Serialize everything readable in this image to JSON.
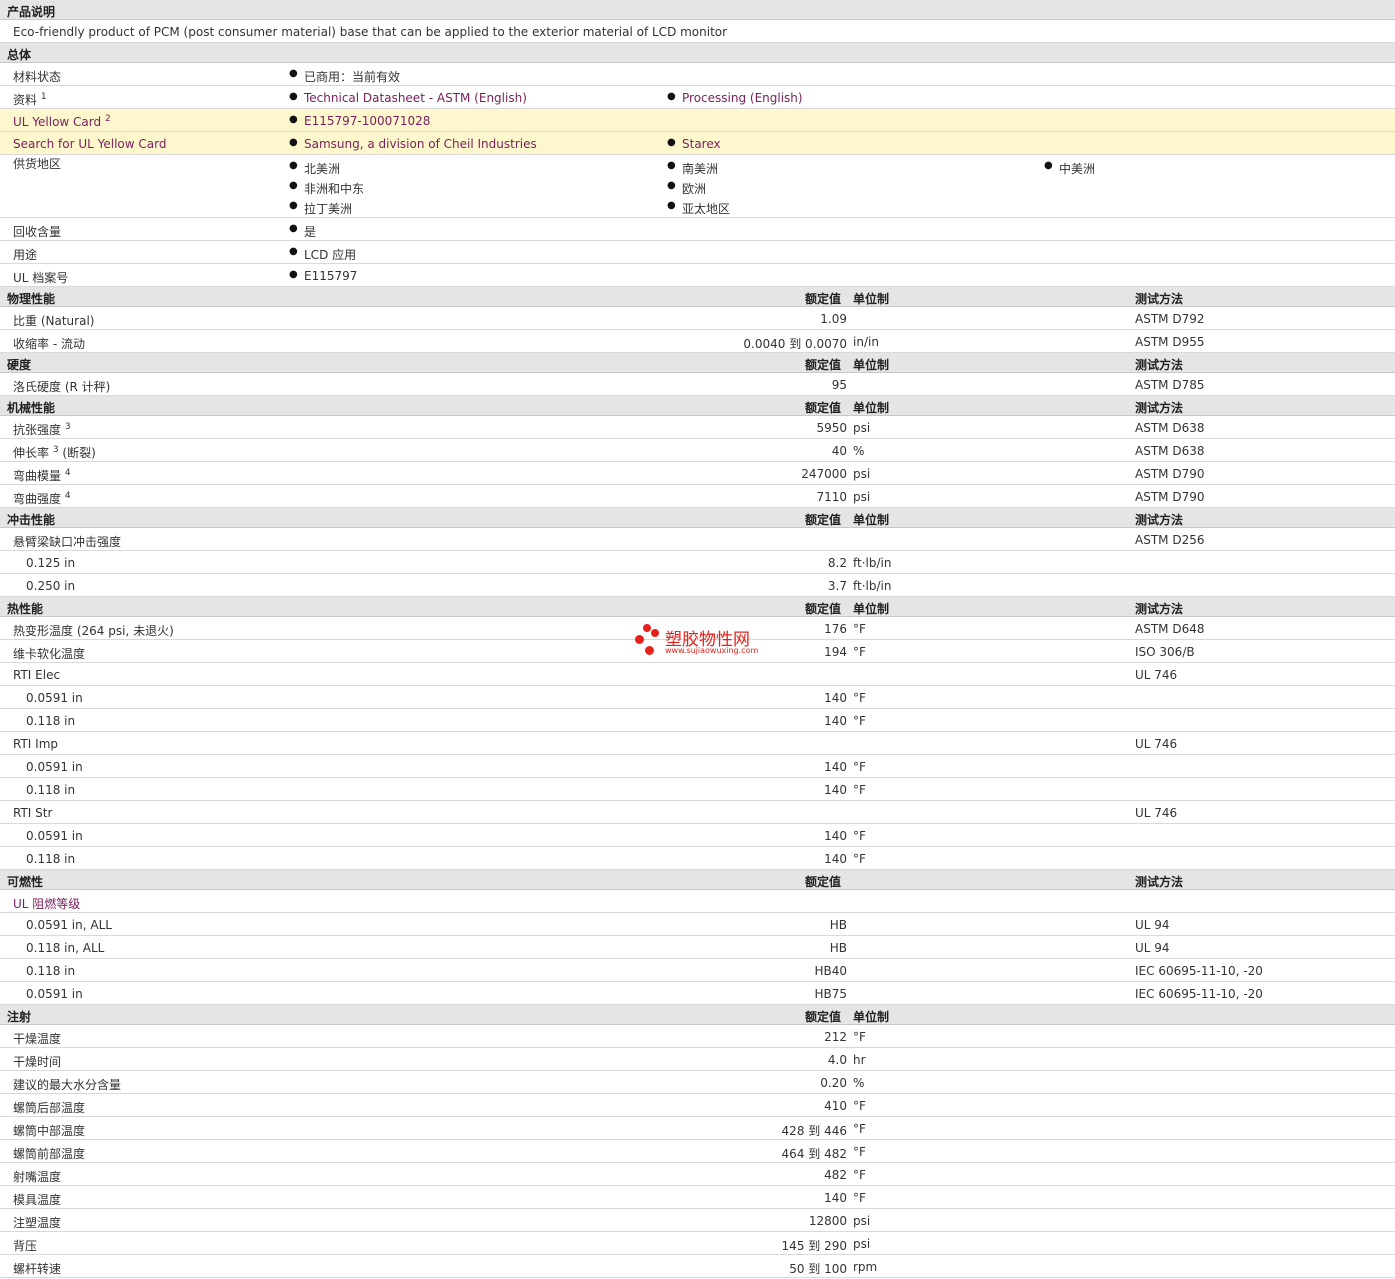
{
  "product_desc": {
    "header": "产品说明",
    "text": "Eco-friendly product of PCM (post consumer material) base that can be applied to the exterior material of LCD monitor"
  },
  "general": {
    "header": "总体",
    "material_status": {
      "label": "材料状态",
      "value": "已商用：当前有效"
    },
    "documents": {
      "label": "资料",
      "sup": "1",
      "items": [
        "Technical Datasheet - ASTM (English)",
        "Processing (English)"
      ]
    },
    "ul_yellow_card": {
      "label": "UL Yellow Card",
      "sup": "2",
      "value": "E115797-100071028"
    },
    "search_ul": {
      "label": "Search for UL Yellow Card",
      "items": [
        "Samsung, a division of Cheil Industries",
        "Starex"
      ]
    },
    "supply": {
      "label": "供货地区",
      "items": [
        "北美洲",
        "南美洲",
        "中美洲",
        "非洲和中东",
        "欧洲",
        "拉丁美洲",
        "亚太地区"
      ]
    },
    "recycled": {
      "label": "回收含量",
      "value": "是"
    },
    "use": {
      "label": "用途",
      "value": "LCD 应用"
    },
    "ul_file": {
      "label": "UL 档案号",
      "value": "E115797"
    }
  },
  "col_headers": {
    "value": "额定值",
    "unit": "单位制",
    "method": "测试方法"
  },
  "physical": {
    "header": "物理性能",
    "rows": [
      {
        "label": "比重",
        "cond": "(Natural)",
        "value": "1.09",
        "unit": "",
        "method": "ASTM D792"
      },
      {
        "label": "收缩率",
        "cond": "- 流动",
        "value": "0.0040 到  0.0070",
        "unit": "in/in",
        "method": "ASTM D955"
      }
    ]
  },
  "hardness": {
    "header": "硬度",
    "rows": [
      {
        "label": "洛氏硬度",
        "cond": "(R 计秤)",
        "value": "95",
        "unit": "",
        "method": "ASTM D785"
      }
    ]
  },
  "mechanical": {
    "header": "机械性能",
    "rows": [
      {
        "label": "抗张强度",
        "sup": "3",
        "value": "5950",
        "unit": "psi",
        "method": "ASTM D638"
      },
      {
        "label": "伸长率",
        "sup": "3",
        "cond": "(断裂)",
        "value": "40",
        "unit": "%",
        "method": "ASTM D638"
      },
      {
        "label": "弯曲模量",
        "sup": "4",
        "value": "247000",
        "unit": "psi",
        "method": "ASTM D790"
      },
      {
        "label": "弯曲强度",
        "sup": "4",
        "value": "7110",
        "unit": "psi",
        "method": "ASTM D790"
      }
    ]
  },
  "impact": {
    "header": "冲击性能",
    "rows": [
      {
        "label": "悬臂梁缺口冲击强度",
        "method": "ASTM D256"
      },
      {
        "label": "0.125 in",
        "value": "8.2",
        "unit": "ft·lb/in"
      },
      {
        "label": "0.250 in",
        "value": "3.7",
        "unit": "ft·lb/in"
      }
    ]
  },
  "thermal": {
    "header": "热性能",
    "rows": [
      {
        "label": "热变形温度",
        "cond": "(264 psi, 未退火)",
        "value": "176",
        "unit": "°F",
        "method": "ASTM D648"
      },
      {
        "label": "维卡软化温度",
        "value": "194",
        "unit": "°F",
        "method": "ISO 306/B"
      },
      {
        "label": "RTI Elec",
        "method": "UL 746"
      },
      {
        "label": "0.0591 in",
        "value": "140",
        "unit": "°F"
      },
      {
        "label": "0.118 in",
        "value": "140",
        "unit": "°F"
      },
      {
        "label": "RTI Imp",
        "method": "UL 746"
      },
      {
        "label": "0.0591 in",
        "value": "140",
        "unit": "°F"
      },
      {
        "label": "0.118 in",
        "value": "140",
        "unit": "°F"
      },
      {
        "label": "RTI Str",
        "method": "UL 746"
      },
      {
        "label": "0.0591 in",
        "value": "140",
        "unit": "°F"
      },
      {
        "label": "0.118 in",
        "value": "140",
        "unit": "°F"
      }
    ]
  },
  "flammability": {
    "header": "可燃性",
    "rows": [
      {
        "label": "UL 阻燃等级"
      },
      {
        "label": "0.0591 in, ALL",
        "value": "HB",
        "method": "UL 94"
      },
      {
        "label": "0.118 in, ALL",
        "value": "HB",
        "method": "UL 94"
      },
      {
        "label": "0.118 in",
        "value": "HB40",
        "method": "IEC 60695-11-10, -20"
      },
      {
        "label": "0.0591 in",
        "value": "HB75",
        "method": "IEC 60695-11-10, -20"
      }
    ]
  },
  "injection": {
    "header": "注射",
    "rows": [
      {
        "label": "干燥温度",
        "value": "212",
        "unit": "°F"
      },
      {
        "label": "干燥时间",
        "value": "4.0",
        "unit": "hr"
      },
      {
        "label": "建议的最大水分含量",
        "value": "0.20",
        "unit": "%"
      },
      {
        "label": "螺筒后部温度",
        "value": "410",
        "unit": "°F"
      },
      {
        "label": "螺筒中部温度",
        "value": "428 到  446",
        "unit": "°F"
      },
      {
        "label": "螺筒前部温度",
        "value": "464 到  482",
        "unit": "°F"
      },
      {
        "label": "射嘴温度",
        "value": "482",
        "unit": "°F"
      },
      {
        "label": "模具温度",
        "value": "140",
        "unit": "°F"
      },
      {
        "label": "注塑温度",
        "value": "12800",
        "unit": "psi"
      },
      {
        "label": "背压",
        "value": "145 到  290",
        "unit": "psi"
      },
      {
        "label": "螺杆转速",
        "value": "50 到  100",
        "unit": "rpm"
      }
    ]
  },
  "watermark": {
    "name": "塑胶物性网",
    "url": "www.sujiaowuxing.com"
  },
  "colors": {
    "header_bg": "#e5e5e5",
    "yellow_bg": "#fcf7cc",
    "link": "#7a1f5c",
    "watermark": "#e8201b"
  }
}
